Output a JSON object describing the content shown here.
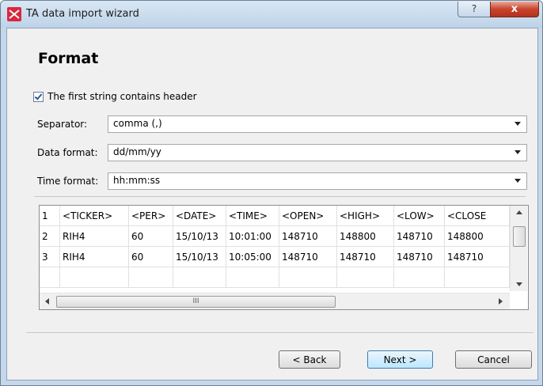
{
  "window": {
    "title": "TA data import wizard",
    "help_glyph": "?",
    "close_glyph": "x"
  },
  "page": {
    "heading": "Format"
  },
  "header_checkbox": {
    "label": "The first string contains header",
    "checked": true
  },
  "fields": [
    {
      "label": "Separator:",
      "value": "comma (,)"
    },
    {
      "label": "Data format:",
      "value": "dd/mm/yy"
    },
    {
      "label": "Time format:",
      "value": "hh:mm:ss"
    }
  ],
  "preview_table": {
    "rows": [
      [
        "1",
        "<TICKER>",
        "<PER>",
        "<DATE>",
        "<TIME>",
        "<OPEN>",
        "<HIGH>",
        "<LOW>",
        "<CLOSE"
      ],
      [
        "2",
        "RIH4",
        "60",
        "15/10/13",
        "10:01:00",
        "148710",
        "148800",
        "148710",
        "148800"
      ],
      [
        "3",
        "RIH4",
        "60",
        "15/10/13",
        "10:05:00",
        "148710",
        "148710",
        "148710",
        "148710"
      ]
    ],
    "hscroll_thumb_glyph": "III"
  },
  "buttons": {
    "back": "< Back",
    "next": "Next >",
    "cancel": "Cancel"
  },
  "colors": {
    "accent": "#3c7fb1",
    "title_bar": "#c5d7ea",
    "close_button": "#c8442d"
  }
}
